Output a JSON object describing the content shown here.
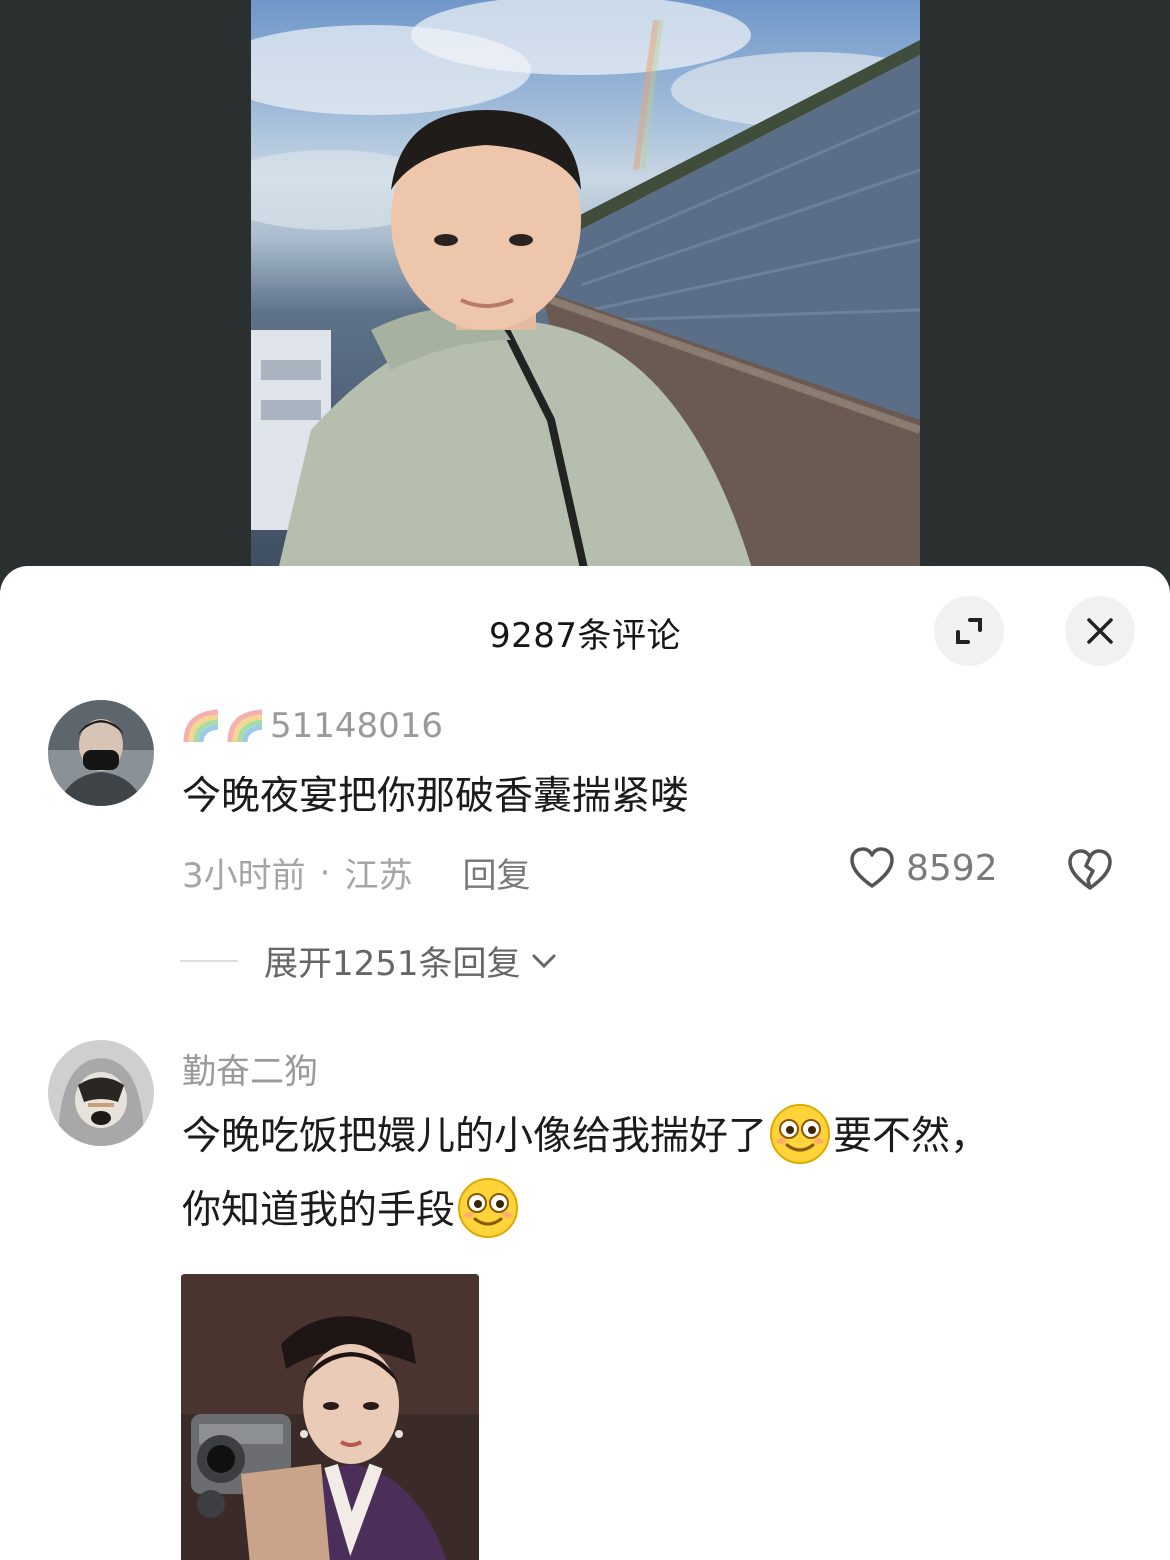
{
  "sheet": {
    "title": "9287条评论",
    "expand_icon": "expand-icon",
    "close_icon": "close-icon"
  },
  "comments": [
    {
      "username_prefix_icons": [
        "rainbow-icon",
        "rainbow-icon"
      ],
      "username": "51148016",
      "text": "今晚夜宴把你那破香囊揣紧喽",
      "time": "3小时前",
      "separator": "·",
      "location": "江苏",
      "reply_label": "回复",
      "likes": "8592",
      "expand_replies": "展开1251条回复"
    },
    {
      "username": "勤奋二狗",
      "text_part1": "今晚吃饭把嬛儿的小像给我揣好了",
      "text_part2": "要不然，",
      "text_part3": "你知道我的手段",
      "emoji_icon": "grin-emoji-icon"
    }
  ],
  "colors": {
    "background": "#2a302f",
    "sheet": "#ffffff",
    "button_bg": "#f1f1f2",
    "secondary_text": "#a5a5a5"
  }
}
